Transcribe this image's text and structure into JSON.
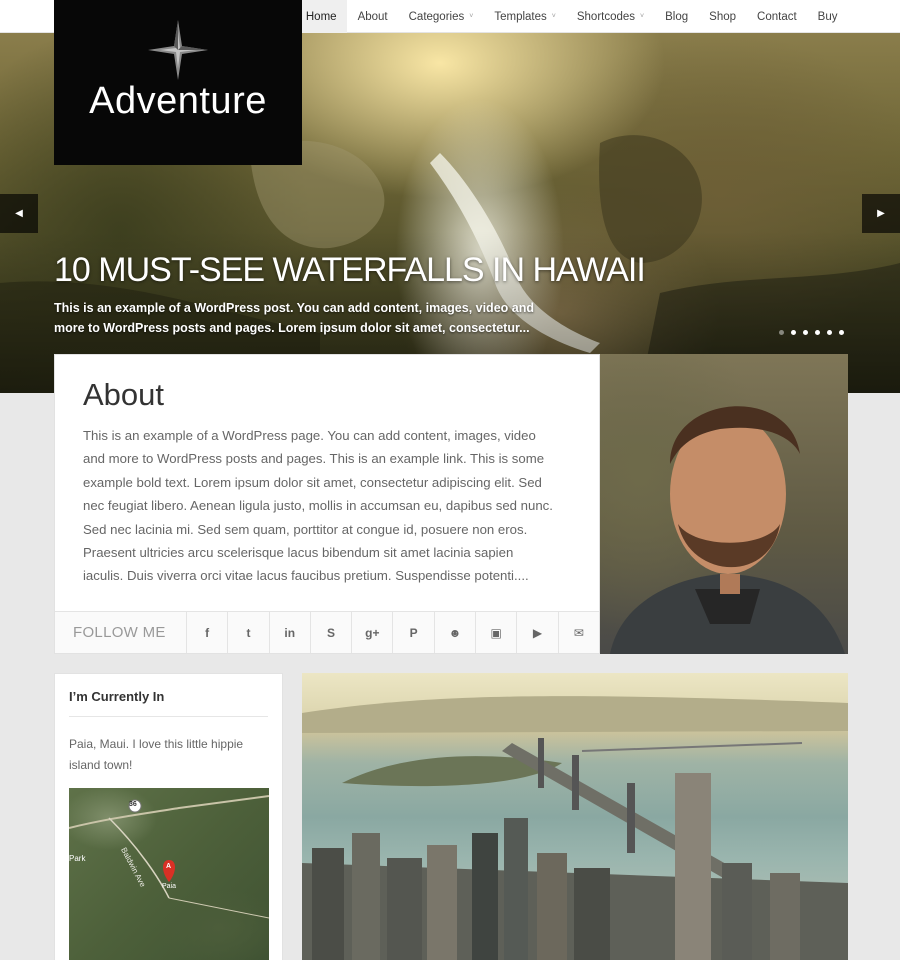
{
  "nav": {
    "items": [
      {
        "label": "Home",
        "dropdown": false,
        "active": true
      },
      {
        "label": "About",
        "dropdown": false,
        "active": false
      },
      {
        "label": "Categories",
        "dropdown": true,
        "active": false
      },
      {
        "label": "Templates",
        "dropdown": true,
        "active": false
      },
      {
        "label": "Shortcodes",
        "dropdown": true,
        "active": false
      },
      {
        "label": "Blog",
        "dropdown": false,
        "active": false
      },
      {
        "label": "Shop",
        "dropdown": false,
        "active": false
      },
      {
        "label": "Contact",
        "dropdown": false,
        "active": false
      },
      {
        "label": "Buy",
        "dropdown": false,
        "active": false
      }
    ],
    "caret": "˅"
  },
  "logo": {
    "text": "Adventure",
    "icon": "compass-star-icon"
  },
  "slider": {
    "title": "10 MUST-SEE WATERFALLS IN HAWAII",
    "excerpt": "This is an example of a WordPress post. You can add content, images, video and more to WordPress posts and pages. Lorem ipsum dolor sit amet, consectetur...",
    "prev_glyph": "◀",
    "next_glyph": "▶",
    "dot_count": 6,
    "active_dot": 1
  },
  "about": {
    "title": "About",
    "text": "This is an example of a WordPress page. You can add content, images, video and more to WordPress posts and pages. This is an example link. This is some example bold text. Lorem ipsum dolor sit amet, consectetur adipiscing elit. Sed nec feugiat libero. Aenean ligula justo, mollis in accumsan eu, dapibus sed nunc. Sed nec lacinia mi. Sed sem quam, porttitor at congue id, posuere non eros. Praesent ultricies arcu scelerisque lacus bibendum sit amet lacinia sapien iaculis. Duis viverra orci vitae lacus faucibus pretium. Suspendisse potenti....",
    "follow_label": "FOLLOW ME",
    "social": [
      {
        "icon": "facebook-icon",
        "glyph": "f"
      },
      {
        "icon": "twitter-icon",
        "glyph": "t"
      },
      {
        "icon": "linkedin-icon",
        "glyph": "in"
      },
      {
        "icon": "skype-icon",
        "glyph": "S"
      },
      {
        "icon": "google-plus-icon",
        "glyph": "g+"
      },
      {
        "icon": "pinterest-icon",
        "glyph": "P"
      },
      {
        "icon": "github-icon",
        "glyph": "☻"
      },
      {
        "icon": "instagram-icon",
        "glyph": "▣"
      },
      {
        "icon": "youtube-icon",
        "glyph": "▶"
      },
      {
        "icon": "email-icon",
        "glyph": "✉"
      }
    ]
  },
  "widget": {
    "title": "I’m Currently In",
    "text": "Paia, Maui. I love this little hippie island town!",
    "map": {
      "pin_label": "A",
      "place": "Paia",
      "road_label": "36",
      "road_name": "Baldwin Ave",
      "edge_text": "Park"
    }
  },
  "colors": {
    "nav_active_bg": "#efefef",
    "logo_bg": "#070707",
    "page_bg": "#e8e8e8"
  }
}
